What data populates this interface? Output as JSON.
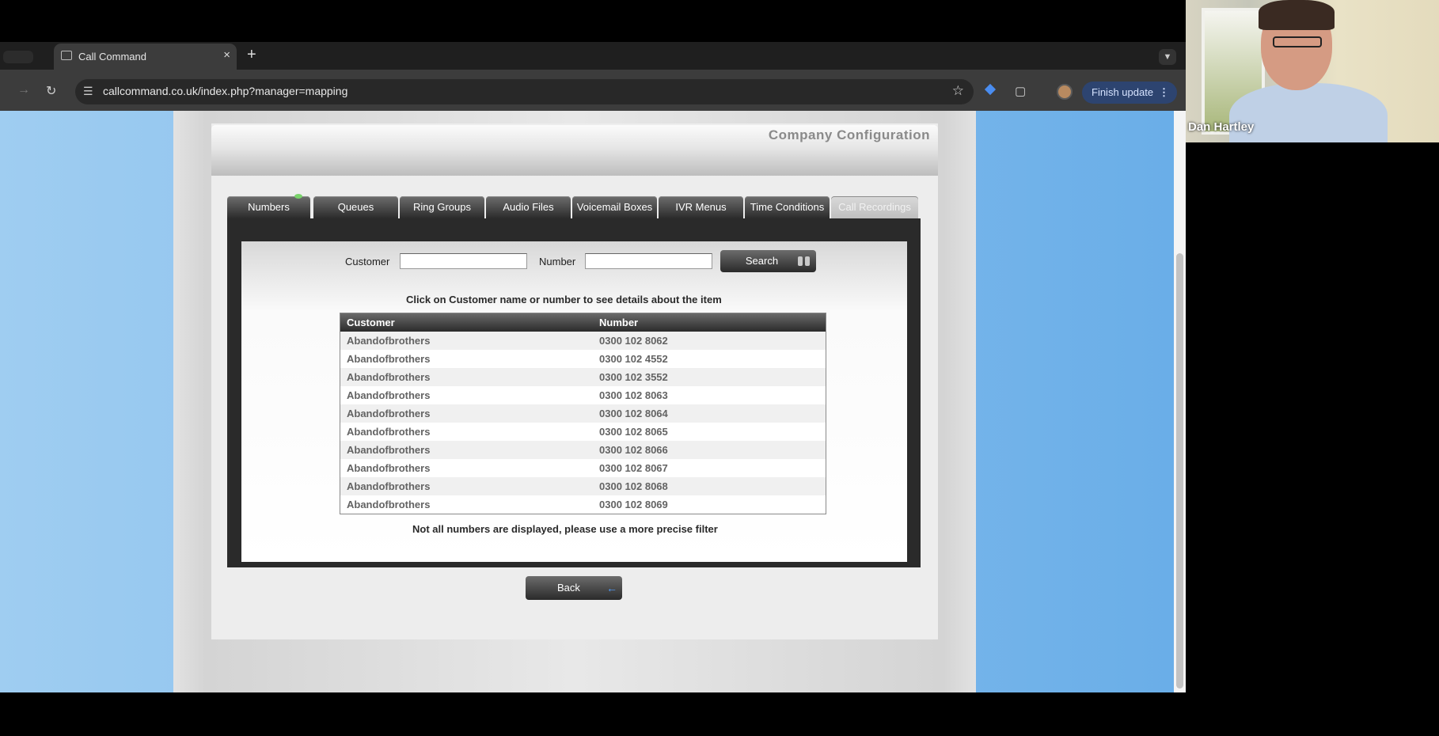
{
  "browser": {
    "tab_title": "Call Command",
    "new_tab_symbol": "+",
    "tab_close_symbol": "×",
    "url": "callcommand.co.uk/index.php?manager=mapping",
    "update_button": "Finish update"
  },
  "page": {
    "header_title": "Company Configuration",
    "tabs": [
      {
        "label": "Numbers",
        "state": "active"
      },
      {
        "label": "Queues",
        "state": "normal"
      },
      {
        "label": "Ring Groups",
        "state": "normal"
      },
      {
        "label": "Audio Files",
        "state": "normal"
      },
      {
        "label": "Voicemail Boxes",
        "state": "normal"
      },
      {
        "label": "IVR Menus",
        "state": "normal"
      },
      {
        "label": "Time Conditions",
        "state": "normal"
      },
      {
        "label": "Call Recordings",
        "state": "disabled"
      }
    ],
    "filter": {
      "customer_label": "Customer",
      "customer_value": "",
      "number_label": "Number",
      "number_value": "",
      "search_button": "Search"
    },
    "instruction": "Click on Customer name or number to see details about the item",
    "table": {
      "headers": [
        "Customer",
        "Number"
      ],
      "rows": [
        [
          "Abandofbrothers",
          "0300 102 8062"
        ],
        [
          "Abandofbrothers",
          "0300 102 4552"
        ],
        [
          "Abandofbrothers",
          "0300 102 3552"
        ],
        [
          "Abandofbrothers",
          "0300 102 8063"
        ],
        [
          "Abandofbrothers",
          "0300 102 8064"
        ],
        [
          "Abandofbrothers",
          "0300 102 8065"
        ],
        [
          "Abandofbrothers",
          "0300 102 8066"
        ],
        [
          "Abandofbrothers",
          "0300 102 8067"
        ],
        [
          "Abandofbrothers",
          "0300 102 8068"
        ],
        [
          "Abandofbrothers",
          "0300 102 8069"
        ]
      ]
    },
    "notice": "Not all numbers are displayed, please use a more precise filter",
    "back_button": "Back"
  },
  "video": {
    "participant_name": "Dan Hartley"
  },
  "colors": {
    "page_background": "#6aaee8",
    "button_dark": "#2b2b2b",
    "active_tab_indicator": "#79d36a",
    "back_arrow": "#4f9dff",
    "update_button_bg": "#2d4470"
  }
}
